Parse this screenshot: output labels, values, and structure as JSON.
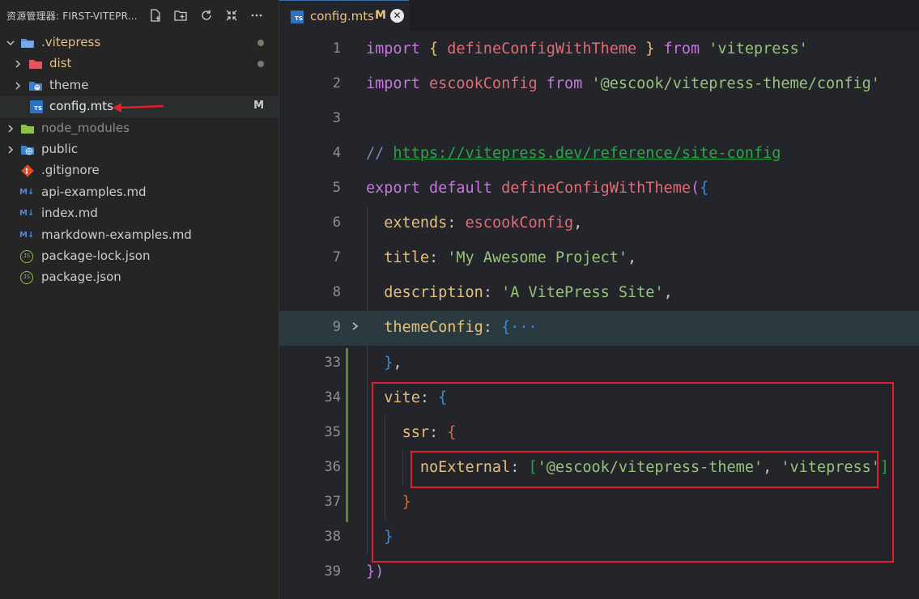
{
  "sidebar": {
    "title": "资源管理器: FIRST-VITEPR...",
    "header_icons": [
      "new-file-icon",
      "new-folder-icon",
      "refresh-icon",
      "collapse-all-icon",
      "more-icon"
    ],
    "items": [
      {
        "label": ".vitepress",
        "icon": "folder-icon",
        "badge": "dot"
      },
      {
        "label": "dist",
        "icon": "folder-icon",
        "badge": "dot"
      },
      {
        "label": "theme",
        "icon": "palette-folder-icon",
        "badge": ""
      },
      {
        "label": "config.mts",
        "icon": "typescript-file-icon",
        "badge": "M"
      },
      {
        "label": "node_modules",
        "icon": "folder-icon",
        "badge": ""
      },
      {
        "label": "public",
        "icon": "globe-folder-icon",
        "badge": ""
      },
      {
        "label": ".gitignore",
        "icon": "git-icon",
        "badge": ""
      },
      {
        "label": "api-examples.md",
        "icon": "markdown-icon",
        "badge": ""
      },
      {
        "label": "index.md",
        "icon": "markdown-icon",
        "badge": ""
      },
      {
        "label": "markdown-examples.md",
        "icon": "markdown-icon",
        "badge": ""
      },
      {
        "label": "package-lock.json",
        "icon": "json-icon",
        "badge": ""
      },
      {
        "label": "package.json",
        "icon": "json-icon",
        "badge": ""
      }
    ]
  },
  "tab": {
    "name": "config.mts",
    "modified": "M",
    "close": "✕",
    "icon_text": "TS"
  },
  "icon_text": {
    "ts": "TS",
    "md": "M↓",
    "json": "JS"
  },
  "colors": {
    "accent": "#3a6ea5",
    "annotation": "#e0202a",
    "modified": "#e8c27e"
  },
  "lines": [
    {
      "n": "1",
      "tokens": [
        [
          "kw",
          "import"
        ],
        [
          "pun",
          " "
        ],
        [
          "b1",
          "{"
        ],
        [
          "pun",
          " "
        ],
        [
          "fn",
          "defineConfigWithTheme"
        ],
        [
          "pun",
          " "
        ],
        [
          "b1",
          "}"
        ],
        [
          "pun",
          " "
        ],
        [
          "kw",
          "from"
        ],
        [
          "pun",
          " "
        ],
        [
          "str",
          "'vitepress'"
        ]
      ]
    },
    {
      "n": "2",
      "tokens": [
        [
          "kw",
          "import"
        ],
        [
          "pun",
          " "
        ],
        [
          "fn",
          "escookConfig"
        ],
        [
          "pun",
          " "
        ],
        [
          "kw",
          "from"
        ],
        [
          "pun",
          " "
        ],
        [
          "str",
          "'@escook/vitepress-theme/config'"
        ]
      ]
    },
    {
      "n": "3",
      "tokens": []
    },
    {
      "n": "4",
      "tokens": [
        [
          "cm",
          "// "
        ],
        [
          "lnk",
          "https://vitepress.dev/reference/site-config"
        ]
      ]
    },
    {
      "n": "5",
      "tokens": [
        [
          "kw",
          "export default "
        ],
        [
          "fn",
          "defineConfigWithTheme"
        ],
        [
          "b5",
          "("
        ],
        [
          "b2",
          "{"
        ]
      ]
    },
    {
      "n": "6",
      "tokens": [
        [
          "pun",
          "  "
        ],
        [
          "prop",
          "extends"
        ],
        [
          "pun",
          ": "
        ],
        [
          "fn",
          "escookConfig"
        ],
        [
          "pun",
          ","
        ]
      ]
    },
    {
      "n": "7",
      "tokens": [
        [
          "pun",
          "  "
        ],
        [
          "prop",
          "title"
        ],
        [
          "pun",
          ": "
        ],
        [
          "str",
          "'My Awesome Project'"
        ],
        [
          "pun",
          ","
        ]
      ]
    },
    {
      "n": "8",
      "tokens": [
        [
          "pun",
          "  "
        ],
        [
          "prop",
          "description"
        ],
        [
          "pun",
          ": "
        ],
        [
          "str",
          "'A VitePress Site'"
        ],
        [
          "pun",
          ","
        ]
      ]
    },
    {
      "n": "9",
      "tokens": [
        [
          "pun",
          "  "
        ],
        [
          "prop",
          "themeConfig"
        ],
        [
          "pun",
          ": "
        ],
        [
          "b2",
          "{"
        ],
        [
          "ell",
          "···"
        ]
      ]
    },
    {
      "n": "33",
      "tokens": [
        [
          "pun",
          "  "
        ],
        [
          "b2",
          "}"
        ],
        [
          "pun",
          ","
        ]
      ]
    },
    {
      "n": "34",
      "tokens": [
        [
          "pun",
          "  "
        ],
        [
          "prop",
          "vite"
        ],
        [
          "pun",
          ": "
        ],
        [
          "b2",
          "{"
        ]
      ]
    },
    {
      "n": "35",
      "tokens": [
        [
          "pun",
          "    "
        ],
        [
          "prop",
          "ssr"
        ],
        [
          "pun",
          ": "
        ],
        [
          "b3",
          "{"
        ]
      ]
    },
    {
      "n": "36",
      "tokens": [
        [
          "pun",
          "      "
        ],
        [
          "prop",
          "noExternal"
        ],
        [
          "pun",
          ": "
        ],
        [
          "b4",
          "["
        ],
        [
          "str",
          "'@escook/vitepress-theme'"
        ],
        [
          "pun",
          ", "
        ],
        [
          "str",
          "'vitepress'"
        ],
        [
          "b4",
          "]"
        ]
      ]
    },
    {
      "n": "37",
      "tokens": [
        [
          "pun",
          "    "
        ],
        [
          "b3",
          "}"
        ]
      ]
    },
    {
      "n": "38",
      "tokens": [
        [
          "pun",
          "  "
        ],
        [
          "b2",
          "}"
        ]
      ]
    },
    {
      "n": "39",
      "tokens": [
        [
          "b5",
          "}"
        ],
        [
          "b5",
          ")"
        ]
      ]
    }
  ]
}
